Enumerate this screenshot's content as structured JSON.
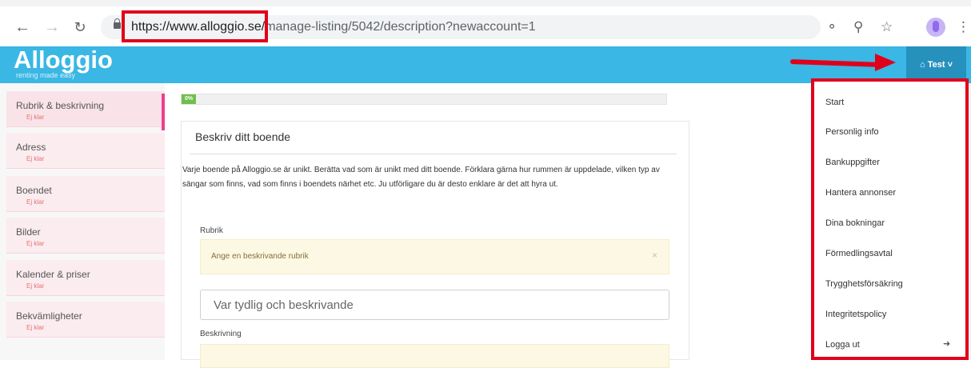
{
  "browser": {
    "url_host": "https://www.alloggio.se/",
    "url_path": "manage-listing/5042/description?newaccount=1"
  },
  "header": {
    "logo": "Alloggio",
    "tagline": "renting made easy",
    "user_menu_label": "Test",
    "accent_color": "#3ab7e4",
    "highlight_color": "#e0001b"
  },
  "sidebar": {
    "items": [
      {
        "label": "Rubrik & beskrivning",
        "status": "Ej klar"
      },
      {
        "label": "Adress",
        "status": "Ej klar"
      },
      {
        "label": "Boendet",
        "status": "Ej klar"
      },
      {
        "label": "Bilder",
        "status": "Ej klar"
      },
      {
        "label": "Kalender & priser",
        "status": "Ej klar"
      },
      {
        "label": "Bekvämligheter",
        "status": "Ej klar"
      }
    ]
  },
  "main": {
    "progress_label": "0%",
    "progress_value": 0,
    "title": "Beskriv ditt boende",
    "description": "Varje boende på Alloggio.se är unikt. Berätta vad som är unikt med ditt boende. Förklara gärna hur rummen är uppdelade, vilken typ av sängar som finns, vad som finns i boendets närhet etc. Ju utförligare du är desto enklare är det att hyra ut.",
    "rubrik_label": "Rubrik",
    "rubrik_alert": "Ange en beskrivande rubrik",
    "rubrik_placeholder": "Var tydlig och beskrivande",
    "beskrivning_label": "Beskrivning"
  },
  "dropdown": {
    "items": [
      "Start",
      "Personlig info",
      "Bankuppgifter",
      "Hantera annonser",
      "Dina bokningar",
      "Förmedlingsavtal",
      "Trygghetsförsäkring",
      "Integritetspolicy",
      "Logga ut"
    ]
  }
}
